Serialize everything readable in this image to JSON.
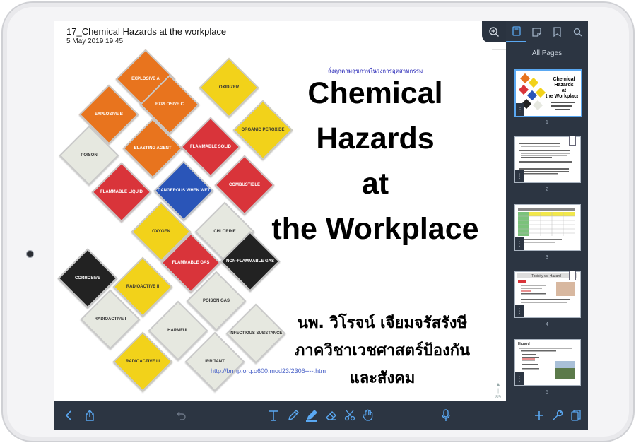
{
  "note": {
    "title": "17_Chemical Hazards at the workplace",
    "date": "5 May 2019 19:45"
  },
  "slide": {
    "thai_header": "สิ่งคุกคามสุขภาพในวงการอุตสาหกรรม",
    "title_lines": [
      "Chemical",
      "Hazards",
      "at",
      "the Workplace"
    ],
    "author_lines": [
      "นพ. วิโรจน์ เจียมจรัสรังษี",
      "ภาควิชาเวชศาสตร์ป้องกัน",
      "และสังคม"
    ],
    "link": "http://brmp.org.o600.mod23/2306----.htm",
    "page_indicator": "89"
  },
  "placards": [
    {
      "label": "EXPLOSIVE A",
      "color": "#e8741e"
    },
    {
      "label": "EXPLOSIVE B",
      "color": "#e8741e"
    },
    {
      "label": "EXPLOSIVE C",
      "color": "#e8741e"
    },
    {
      "label": "OXIDIZER",
      "color": "#f2d21a"
    },
    {
      "label": "ORGANIC PEROXIDE",
      "color": "#f2d21a"
    },
    {
      "label": "BLASTING AGENT",
      "color": "#e8741e"
    },
    {
      "label": "POISON",
      "color": "#e6e8e0"
    },
    {
      "label": "FLAMMABLE SOLID",
      "color": "#d9343a"
    },
    {
      "label": "FLAMMABLE LIQUID",
      "color": "#d9343a"
    },
    {
      "label": "DANGEROUS WHEN WET",
      "color": "#2a55b8"
    },
    {
      "label": "COMBUSTIBLE",
      "color": "#d9343a"
    },
    {
      "label": "OXYGEN",
      "color": "#f2d21a"
    },
    {
      "label": "CHLORINE",
      "color": "#e6e8e0"
    },
    {
      "label": "FLAMMABLE GAS",
      "color": "#d9343a"
    },
    {
      "label": "NON-FLAMMABLE GAS",
      "color": "#222222"
    },
    {
      "label": "CORROSIVE",
      "color": "#222222"
    },
    {
      "label": "RADIOACTIVE II",
      "color": "#f2d21a"
    },
    {
      "label": "POISON GAS",
      "color": "#e6e8e0"
    },
    {
      "label": "RADIOACTIVE I",
      "color": "#e6e8e0"
    },
    {
      "label": "HARMFUL",
      "color": "#e6e8e0"
    },
    {
      "label": "INFECTIOUS SUBSTANCE",
      "color": "#e6e8e0"
    },
    {
      "label": "RADIOACTIVE III",
      "color": "#f2d21a"
    },
    {
      "label": "IRRITANT",
      "color": "#e6e8e0"
    }
  ],
  "sidebar": {
    "tabs": [
      "pages-icon",
      "note-icon",
      "bookmark-icon",
      "search-icon"
    ],
    "heading": "All Pages",
    "thumbnails": [
      {
        "num": "1",
        "title": "Chemical Hazards at the Workplace"
      },
      {
        "num": "2",
        "title": ""
      },
      {
        "num": "3",
        "title": ""
      },
      {
        "num": "4",
        "title": "Toxicity vs. Hazard"
      },
      {
        "num": "5",
        "title": "Hazard"
      }
    ]
  },
  "toolbar": {
    "left": [
      "back-icon",
      "share-icon"
    ],
    "center": [
      "undo-icon",
      "text-tool-icon",
      "pen-tool-icon",
      "highlighter-tool-icon",
      "eraser-tool-icon",
      "lasso-tool-icon",
      "hand-tool-icon"
    ],
    "right": [
      "microphone-icon",
      "add-icon",
      "settings-icon",
      "notebook-icon"
    ]
  },
  "colors": {
    "accent": "#5aa8f2",
    "chrome": "#2c3542"
  }
}
